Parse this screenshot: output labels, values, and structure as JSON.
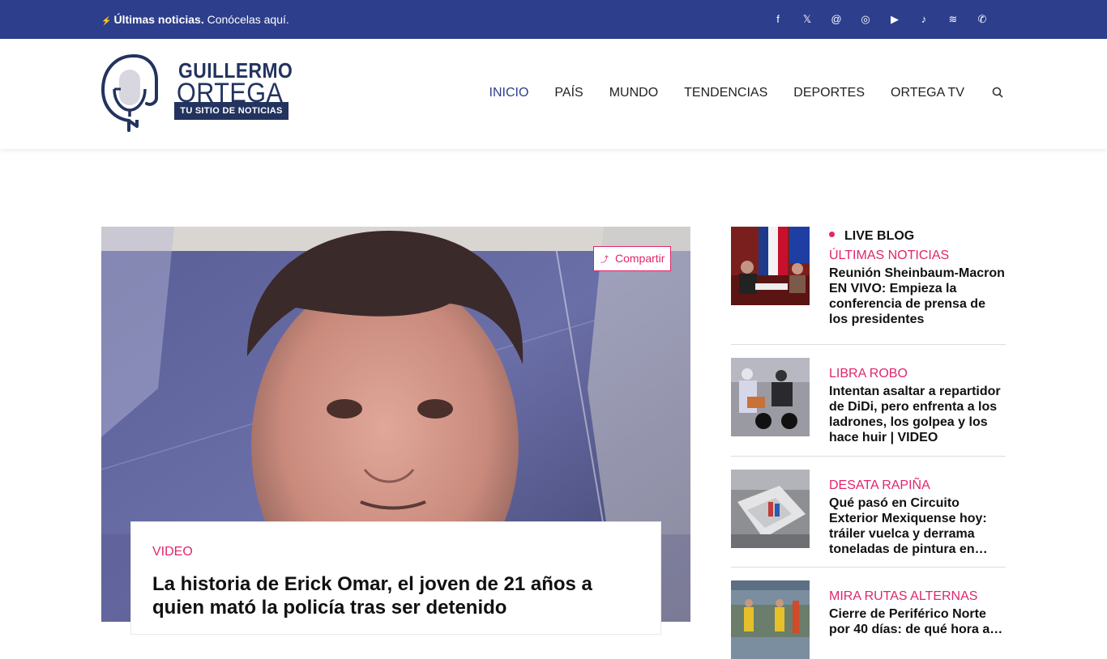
{
  "topbar": {
    "ticker_bold": "Últimas noticias.",
    "ticker_link": "Conócelas aquí.",
    "social_icons": [
      "facebook-icon",
      "twitter-icon",
      "threads-icon",
      "instagram-icon",
      "youtube-icon",
      "tiktok-icon",
      "spotify-icon",
      "whatsapp-icon"
    ]
  },
  "brand": {
    "line1": "GUILLERMO",
    "line2": "ORTEGA",
    "tagline": "TU SITIO DE NOTICIAS"
  },
  "nav": {
    "items": [
      "INICIO",
      "PAÍS",
      "MUNDO",
      "TENDENCIAS",
      "DEPORTES",
      "ORTEGA TV"
    ],
    "active": "INICIO"
  },
  "featured": {
    "share_label": "Compartir",
    "category": "VIDEO",
    "title": "La historia de Erick Omar, el joven de 21 años a quien mató la policía tras ser detenido"
  },
  "sidebar": {
    "live_label": "LIVE BLOG",
    "items": [
      {
        "category": "ÚLTIMAS NOTICIAS",
        "title": "Reunión Sheinbaum-Macron EN VIVO: Empieza la conferencia de prensa de los presidentes"
      },
      {
        "category": "LIBRA ROBO",
        "title": "Intentan asaltar a repartidor de DiDi, pero enfrenta a los ladrones, los golpea y los hace huir | VIDEO"
      },
      {
        "category": "DESATA RAPIÑA",
        "title": "Qué pasó en Circuito Exterior Mexiquense hoy: tráiler vuelca y derrama toneladas de pintura en…"
      },
      {
        "category": "MIRA RUTAS ALTERNAS",
        "title": "Cierre de Periférico Norte por 40 días: de qué hora a…"
      }
    ]
  },
  "colors": {
    "brand_blue": "#2c3e8c",
    "accent_pink": "#e0266d"
  }
}
